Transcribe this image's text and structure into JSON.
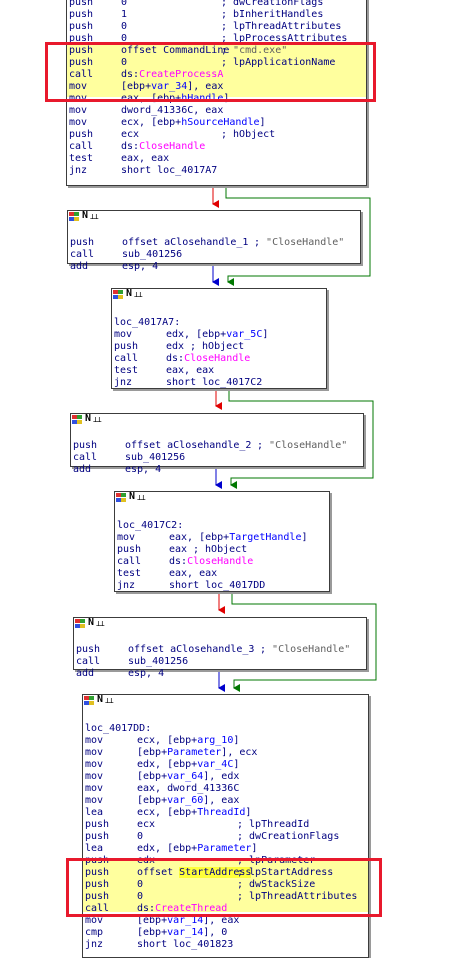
{
  "blocks": {
    "b0": {
      "lines": [
        {
          "op": "push",
          "args": "0",
          "cmt": "; dwCreationFlags"
        },
        {
          "op": "push",
          "args": "1",
          "cmt": "; bInheritHandles"
        },
        {
          "op": "push",
          "args": "0",
          "cmt": "; lpThreadAttributes"
        },
        {
          "op": "push",
          "args": "0",
          "cmt": "; lpProcessAttributes"
        },
        {
          "op": "push",
          "args": "offset CommandLine",
          "cmt": "; \"cmd.exe\""
        },
        {
          "op": "push",
          "args": "0",
          "cmt": "; lpApplicationName"
        },
        {
          "op": "call",
          "args_pre": "ds:",
          "args_fn": "CreateProcessA"
        },
        {
          "op": "mov",
          "args_pre": "[ebp+",
          "args_var": "var_34",
          "args_post": "], eax"
        },
        {
          "op": "mov",
          "args_pre": "eax, [ebp+",
          "args_var": "hHandle",
          "args_post": "]"
        },
        {
          "op": "mov",
          "args": "dword_41336C, eax"
        },
        {
          "op": "mov",
          "args_pre": "ecx, [ebp+",
          "args_var": "hSourceHandle",
          "args_post": "]"
        },
        {
          "op": "push",
          "args": "ecx",
          "cmt": "; hObject"
        },
        {
          "op": "call",
          "args_pre": "ds:",
          "args_fn": "CloseHandle"
        },
        {
          "op": "test",
          "args": "eax, eax"
        },
        {
          "op": "jnz",
          "args": "short loc_4017A7"
        }
      ]
    },
    "b1": {
      "header_n": "N",
      "lines": [
        {
          "op": "push",
          "args": "offset aClosehandle_1",
          "cmt": "; \"CloseHandle\""
        },
        {
          "op": "call",
          "args": "sub_401256"
        },
        {
          "op": "add",
          "args": "esp, 4"
        }
      ]
    },
    "b2": {
      "header_n": "N",
      "label": "loc_4017A7:",
      "lines": [
        {
          "op": "mov",
          "args_pre": "edx, [ebp+",
          "args_var": "var_5C",
          "args_post": "]"
        },
        {
          "op": "push",
          "args": "edx",
          "cmt": "; hObject"
        },
        {
          "op": "call",
          "args_pre": "ds:",
          "args_fn": "CloseHandle"
        },
        {
          "op": "test",
          "args": "eax, eax"
        },
        {
          "op": "jnz",
          "args": "short loc_4017C2"
        }
      ]
    },
    "b3": {
      "header_n": "N",
      "lines": [
        {
          "op": "push",
          "args": "offset aClosehandle_2",
          "cmt": "; \"CloseHandle\""
        },
        {
          "op": "call",
          "args": "sub_401256"
        },
        {
          "op": "add",
          "args": "esp, 4"
        }
      ]
    },
    "b4": {
      "header_n": "N",
      "label": "loc_4017C2:",
      "lines": [
        {
          "op": "mov",
          "args_pre": "eax, [ebp+",
          "args_var": "TargetHandle",
          "args_post": "]"
        },
        {
          "op": "push",
          "args": "eax",
          "cmt": "; hObject"
        },
        {
          "op": "call",
          "args_pre": "ds:",
          "args_fn": "CloseHandle"
        },
        {
          "op": "test",
          "args": "eax, eax"
        },
        {
          "op": "jnz",
          "args": "short loc_4017DD"
        }
      ]
    },
    "b5": {
      "header_n": "N",
      "lines": [
        {
          "op": "push",
          "args": "offset aClosehandle_3",
          "cmt": "; \"CloseHandle\""
        },
        {
          "op": "call",
          "args": "sub_401256"
        },
        {
          "op": "add",
          "args": "esp, 4"
        }
      ]
    },
    "b6": {
      "header_n": "N",
      "label": "loc_4017DD:",
      "lines": [
        {
          "op": "mov",
          "args_pre": "ecx, [ebp+",
          "args_var": "arg_10",
          "args_post": "]"
        },
        {
          "op": "mov",
          "args_pre": "[ebp+",
          "args_var": "Parameter",
          "args_post": "], ecx"
        },
        {
          "op": "mov",
          "args_pre": "edx, [ebp+",
          "args_var": "var_4C",
          "args_post": "]"
        },
        {
          "op": "mov",
          "args_pre": "[ebp+",
          "args_var": "var_64",
          "args_post": "], edx"
        },
        {
          "op": "mov",
          "args": "eax, dword_41336C"
        },
        {
          "op": "mov",
          "args_pre": "[ebp+",
          "args_var": "var_60",
          "args_post": "], eax"
        },
        {
          "op": "lea",
          "args_pre": "ecx, [ebp+",
          "args_var": "ThreadId",
          "args_post": "]"
        },
        {
          "op": "push",
          "args": "ecx",
          "cmt": "; lpThreadId"
        },
        {
          "op": "push",
          "args": "0",
          "cmt": "; dwCreationFlags"
        },
        {
          "op": "lea",
          "args_pre": "edx, [ebp+",
          "args_var": "Parameter",
          "args_post": "]"
        },
        {
          "op": "push",
          "args": "edx",
          "cmt": "; lpParameter"
        },
        {
          "op": "push",
          "args_pre": "offset ",
          "args_yel": "StartAddress",
          "cmt": "; lpStartAddress"
        },
        {
          "op": "push",
          "args": "0",
          "cmt": "; dwStackSize"
        },
        {
          "op": "push",
          "args": "0",
          "cmt": "; lpThreadAttributes"
        },
        {
          "op": "call",
          "args_pre": "ds:",
          "args_fn": "CreateThread"
        },
        {
          "op": "mov",
          "args_pre": "[ebp+",
          "args_var": "var_14",
          "args_post": "], eax"
        },
        {
          "op": "cmp",
          "args_pre": "[ebp+",
          "args_var": "var_14",
          "args_post": "], 0"
        },
        {
          "op": "jnz",
          "args": "short loc_401823"
        }
      ]
    }
  },
  "colors": {
    "edge_true": "#007700",
    "edge_false": "#e00000",
    "edge_uncond": "#0000cc",
    "highlight_box": "#e8192c",
    "highlight_band": "#ffff9e"
  }
}
